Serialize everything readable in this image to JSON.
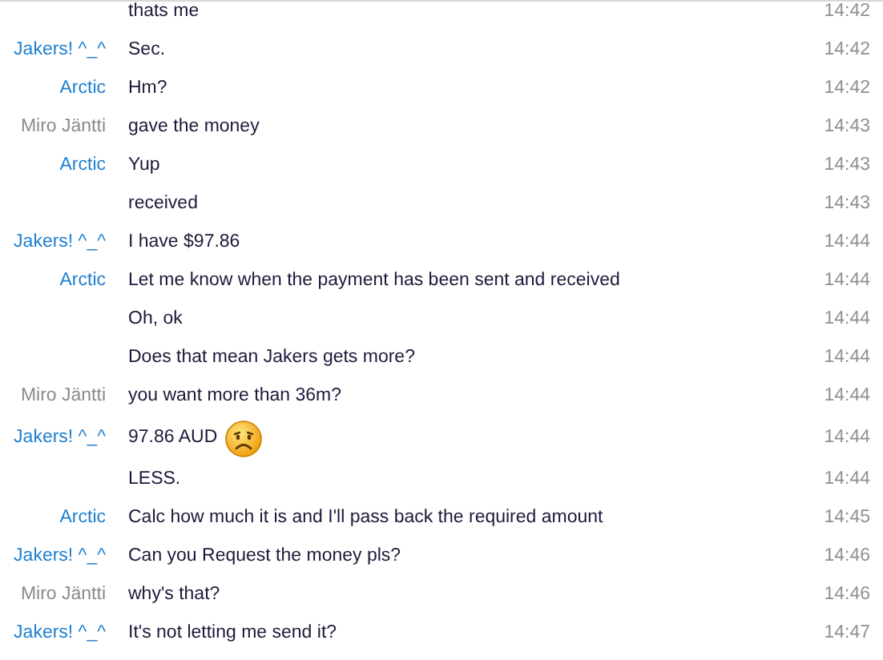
{
  "messages": [
    {
      "text": "thats me",
      "time": "14:42"
    },
    {
      "sender": "Jakers! ^_^",
      "color": "#1e7fd0",
      "text": "Sec.",
      "time": "14:42"
    },
    {
      "sender": "Arctic",
      "color": "#1e7fd0",
      "text": "Hm?",
      "time": "14:42"
    },
    {
      "sender": "Miro Jäntti",
      "color": "#8a8a8a",
      "text": "gave the money",
      "time": "14:43"
    },
    {
      "sender": "Arctic",
      "color": "#1e7fd0",
      "text": "Yup",
      "time": "14:43"
    },
    {
      "text": "received",
      "time": "14:43"
    },
    {
      "sender": "Jakers! ^_^",
      "color": "#1e7fd0",
      "text": "I have $97.86",
      "time": "14:44"
    },
    {
      "sender": "Arctic",
      "color": "#1e7fd0",
      "text": "Let me know when the payment has been sent and received",
      "time": "14:44"
    },
    {
      "text": "Oh, ok",
      "time": "14:44"
    },
    {
      "text": "Does that mean Jakers gets more?",
      "time": "14:44"
    },
    {
      "sender": "Miro Jäntti",
      "color": "#8a8a8a",
      "text": "you want more than 36m?",
      "time": "14:44"
    },
    {
      "sender": "Jakers! ^_^",
      "color": "#1e7fd0",
      "text": "97.86 AUD",
      "kind": "sad",
      "time": "14:44"
    },
    {
      "text": "LESS.",
      "time": "14:44"
    },
    {
      "sender": "Arctic",
      "color": "#1e7fd0",
      "text": "Calc how much it is and I'll pass back the required amount",
      "time": "14:45"
    },
    {
      "sender": "Jakers! ^_^",
      "color": "#1e7fd0",
      "text": "Can you Request the money pls?",
      "time": "14:46"
    },
    {
      "sender": "Miro Jäntti",
      "color": "#8a8a8a",
      "text": "why's that?",
      "time": "14:46"
    },
    {
      "sender": "Jakers! ^_^",
      "color": "#1e7fd0",
      "text": "It's not letting me send it?",
      "time": "14:47"
    }
  ]
}
